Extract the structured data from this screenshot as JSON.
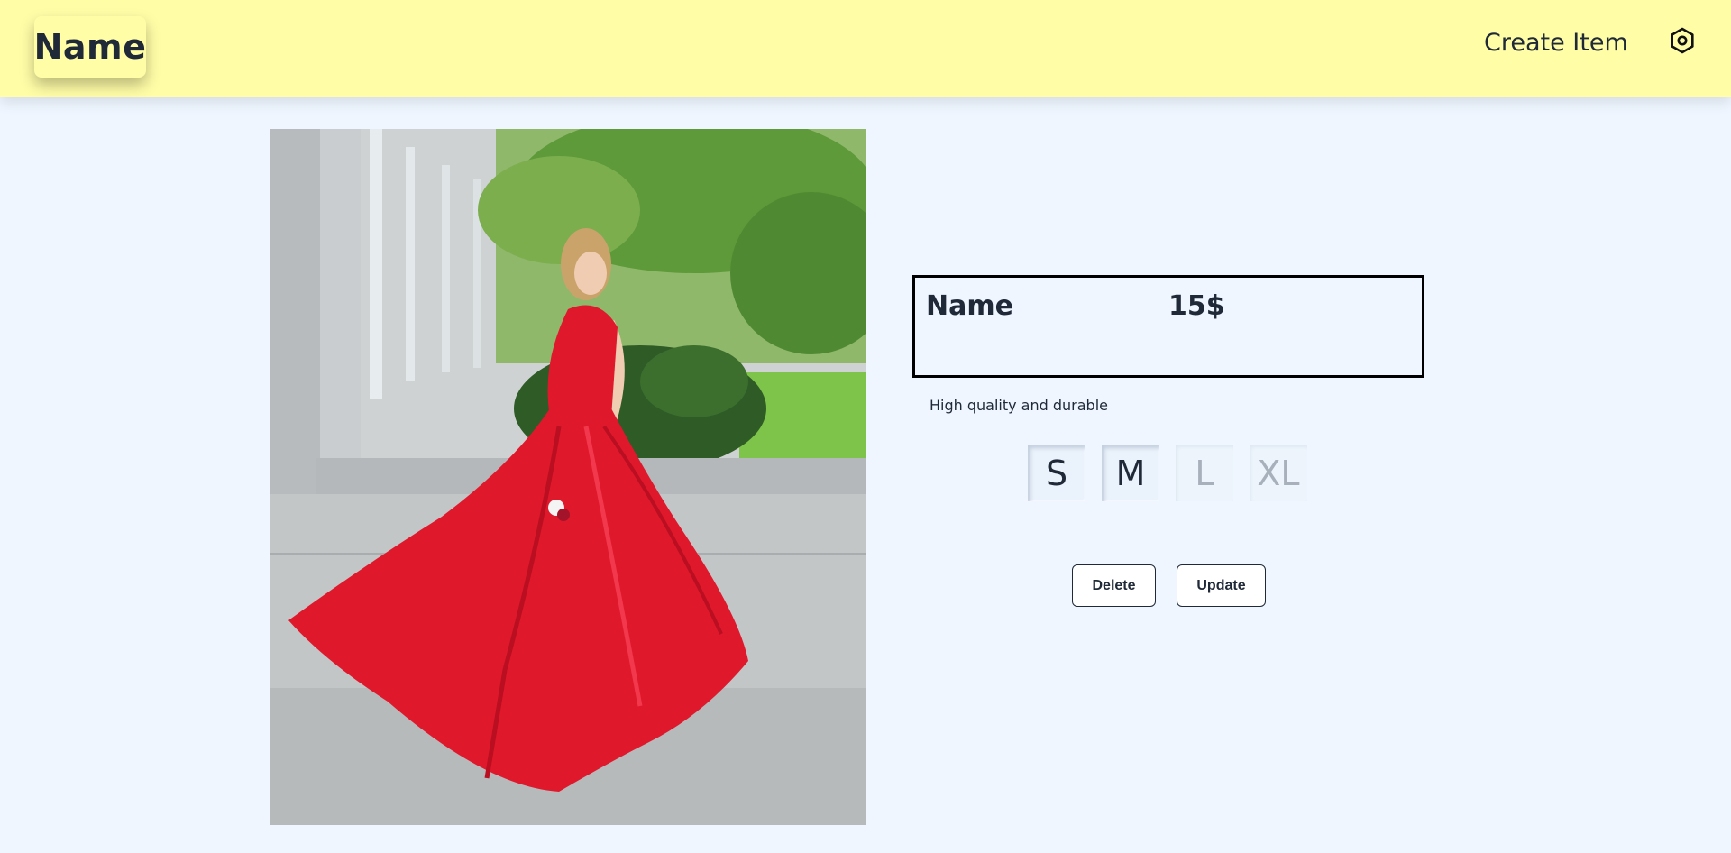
{
  "navbar": {
    "brand": "Name",
    "create_item": "Create Item",
    "settings_icon": "gear-icon"
  },
  "product": {
    "image_icon": "product-photo",
    "name": "Name",
    "price": "15$",
    "description": "High quality and durable",
    "sizes": [
      {
        "label": "S",
        "available": true
      },
      {
        "label": "M",
        "available": true
      },
      {
        "label": "L",
        "available": false
      },
      {
        "label": "XL",
        "available": false
      }
    ]
  },
  "actions": {
    "delete": "Delete",
    "update": "Update"
  },
  "colors": {
    "navbar_bg": "#fffda6",
    "page_bg": "#eff6ff",
    "text": "#1f2937",
    "dress": "#e0182c"
  }
}
